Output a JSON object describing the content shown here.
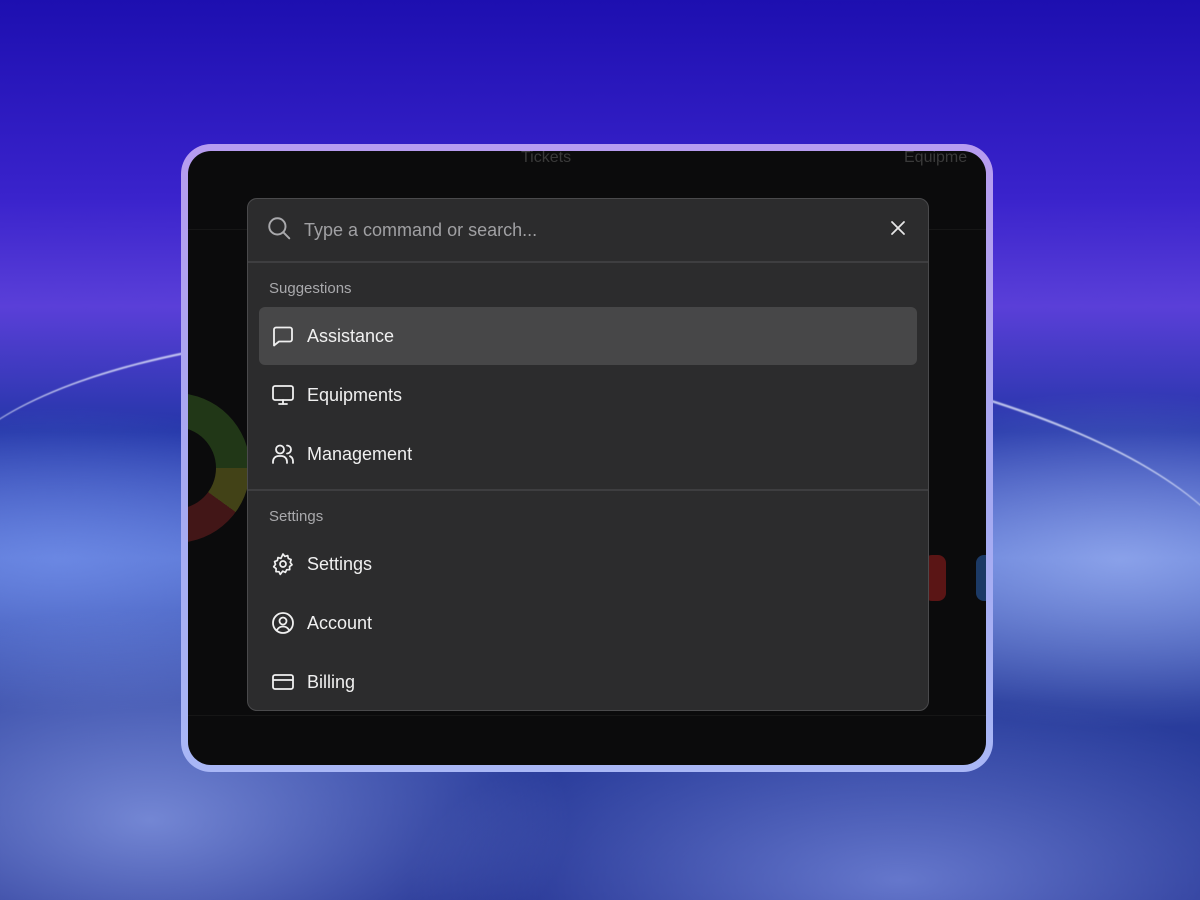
{
  "background_app": {
    "header_labels": [
      "Tickets",
      "Equipme"
    ]
  },
  "palette": {
    "search": {
      "placeholder": "Type a command or search...",
      "value": ""
    },
    "close_icon": "close-icon",
    "sections": [
      {
        "label": "Suggestions",
        "items": [
          {
            "label": "Assistance",
            "icon": "message-square-icon",
            "active": true
          },
          {
            "label": "Equipments",
            "icon": "monitor-icon",
            "active": false
          },
          {
            "label": "Management",
            "icon": "users-icon",
            "active": false
          }
        ]
      },
      {
        "label": "Settings",
        "items": [
          {
            "label": "Settings",
            "icon": "gear-icon",
            "active": false
          },
          {
            "label": "Account",
            "icon": "user-circle-icon",
            "active": false
          },
          {
            "label": "Billing",
            "icon": "credit-card-icon",
            "active": false
          }
        ]
      }
    ]
  },
  "colors": {
    "palette_bg": "#2c2c2d",
    "active_item_bg": "#474748",
    "device_frame": "#a6a9f2"
  }
}
